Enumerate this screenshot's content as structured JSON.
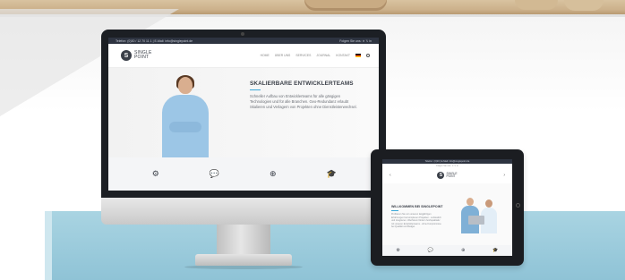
{
  "monitor_site": {
    "topbar_left": "Telefon: (0)30 / 12 70 11 1 | E-Mail: info@singlepoint.de",
    "topbar_right": "Folgen Sie uns: ✕ 𝕏 in",
    "logo_letter": "S",
    "logo_line1": "SINGLE",
    "logo_line2": "POINT",
    "menu": [
      "HOME",
      "ÜBER UNS",
      "SERVICES",
      "JOURNAL",
      "KONTAKT"
    ],
    "hero_title": "SKALIERBARE ENTWICKLERTEAMS",
    "hero_text": "Schneller Aufbau von Entwicklerteams für alle gängigen Technologien und für alle Branchen. Geo-Redundanz erlaubt Skalieren und Verlagern von Projekten ohne Dienstleisterwechsel.",
    "feature_icons": [
      "gears-icon",
      "chat-icon",
      "support-icon",
      "graduation-cap-icon"
    ],
    "feature_glyphs": [
      "⚙",
      "💬",
      "⊕",
      "🎓"
    ]
  },
  "tablet_site": {
    "topbar": "Telefon: (0)30 | E-Mail: info@singlepoint.de",
    "topbar2": "Folgen Sie uns: ✕ 𝕏 in",
    "logo_letter": "S",
    "logo_line1": "SINGLE",
    "logo_line2": "POINT",
    "prev_arrow": "‹",
    "next_arrow": "›",
    "hero_title": "WILLKOMMEN BEI SINGLEPOINT",
    "hero_text": "Profitieren Sie von unseren langjährigen Erfahrungen bei komplexen Projekten - verlässlich und integrieren. Wachstum fördern hochqualitativ mit unseren Entwicklerteams - ohne Kompromisse bei Qualität und Budget.",
    "feature_glyphs": [
      "⚙",
      "💬",
      "⊕",
      "🎓"
    ]
  }
}
